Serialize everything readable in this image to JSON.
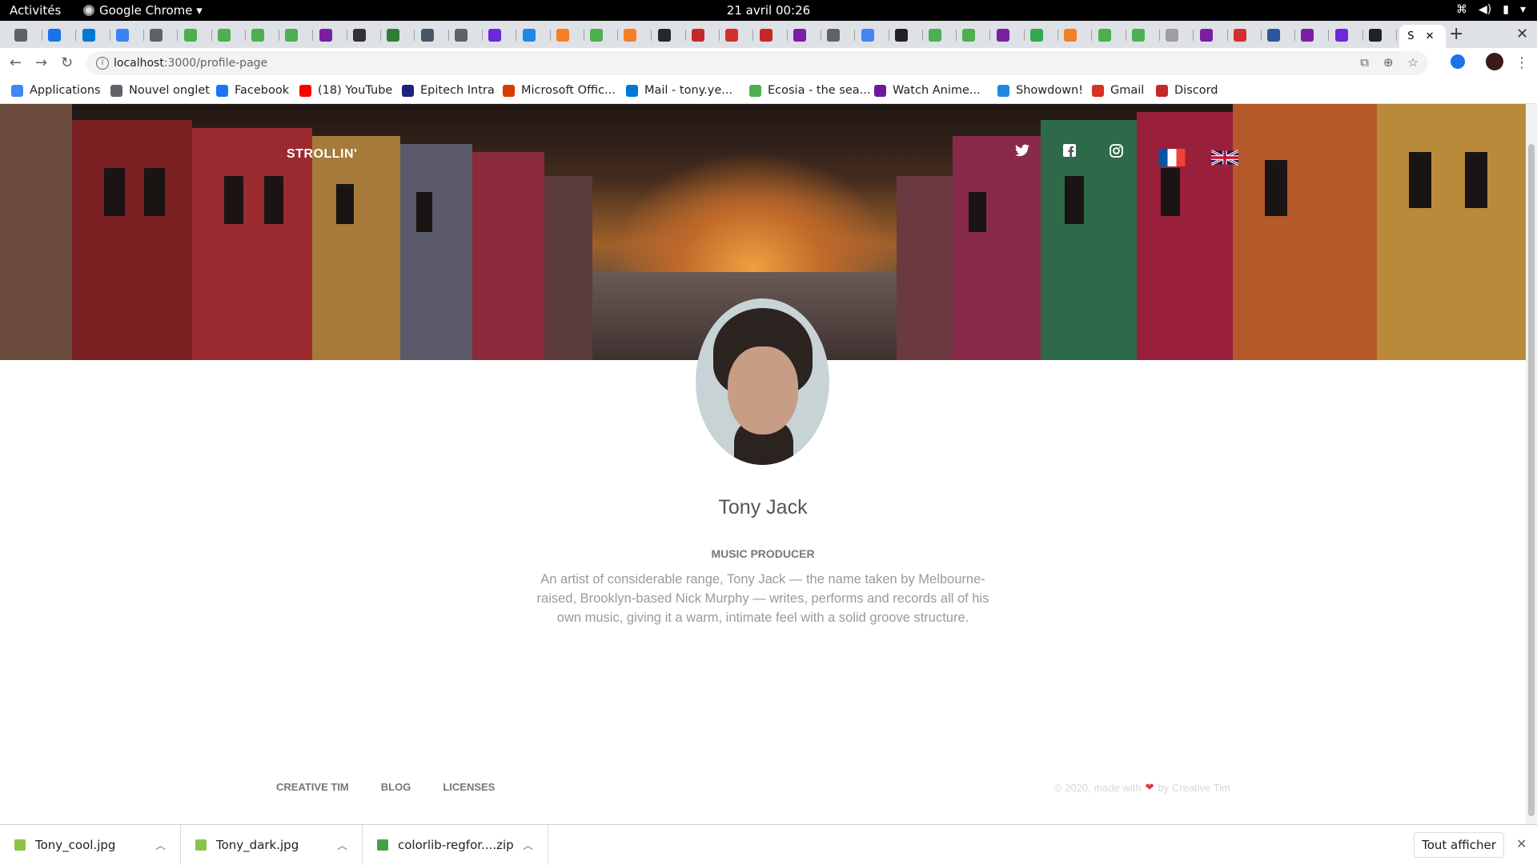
{
  "topbar": {
    "activities": "Activités",
    "app_name": "Google Chrome ▾",
    "datetime": "21 avril  00:26",
    "sys_icons": [
      "network-icon",
      "volume-icon",
      "battery-icon",
      "menu-arrow-icon"
    ]
  },
  "browser": {
    "tab_favicon_colors": [
      "#5f6368",
      "#1a73e8",
      "#0078d4",
      "#3b82f6",
      "#5f6368",
      "#4caf50",
      "#4caf50",
      "#4caf50",
      "#4caf50",
      "#7b1fa2",
      "#333333",
      "#2e7d32",
      "#4a5568",
      "#5f6368",
      "#6d28d9",
      "#1e88e5",
      "#f48024",
      "#4caf50",
      "#f48024",
      "#24292e",
      "#c62828",
      "#d32f2f",
      "#c62828",
      "#7b1fa2",
      "#5f6368",
      "#4285f4",
      "#222222",
      "#4caf50",
      "#4caf50",
      "#7b1fa2",
      "#34a853",
      "#f48024",
      "#4caf50",
      "#4caf50",
      "#9e9e9e",
      "#7b1fa2",
      "#d32f2f",
      "#2b579a",
      "#7b1fa2",
      "#6d28d9",
      "#222222",
      "#ffffff"
    ],
    "active_tab_label": "S",
    "new_tab": "+",
    "close": "✕",
    "url_host": "localhost",
    "url_path": ":3000/profile-page",
    "info_icon": "i"
  },
  "bookmarks": [
    {
      "label": "Applications",
      "color": "#4285f4"
    },
    {
      "label": "Nouvel onglet",
      "color": "#5f6368"
    },
    {
      "label": "Facebook",
      "color": "#1877f2"
    },
    {
      "label": "(18) YouTube",
      "color": "#ff0000"
    },
    {
      "label": "Epitech Intra",
      "color": "#1a237e"
    },
    {
      "label": "Microsoft Offic...",
      "color": "#d83b01"
    },
    {
      "label": "Mail - tony.ye...",
      "color": "#0078d4"
    },
    {
      "label": "Ecosia - the sea...",
      "color": "#4caf50"
    },
    {
      "label": "Watch Anime...",
      "color": "#6a1b9a"
    },
    {
      "label": "Showdown!",
      "color": "#1e88e5"
    },
    {
      "label": "Gmail",
      "color": "#d93025"
    },
    {
      "label": "Discord",
      "color": "#c62828"
    }
  ],
  "site": {
    "brand": "STROLLIN'",
    "social": [
      "twitter-icon",
      "facebook-icon",
      "instagram-icon"
    ],
    "flags": [
      "flag-fr-icon",
      "flag-uk-icon"
    ]
  },
  "profile": {
    "name": "Tony Jack",
    "role": "MUSIC PRODUCER",
    "bio": "An artist of considerable range, Tony Jack — the name taken by Melbourne-raised, Brooklyn-based Nick Murphy — writes, performs and records all of his own music, giving it a warm, intimate feel with a solid groove structure."
  },
  "footer": {
    "links": [
      "CREATIVE TIM",
      "BLOG",
      "LICENSES"
    ],
    "copyright_prefix": "© 2020, made with",
    "heart": "❤",
    "copyright_suffix": "by Creative Tim"
  },
  "downloads": {
    "files": [
      {
        "name": "Tony_cool.jpg",
        "color": "#8bc34a"
      },
      {
        "name": "Tony_dark.jpg",
        "color": "#8bc34a"
      },
      {
        "name": "colorlib-regfor....zip",
        "color": "#43a047"
      }
    ],
    "show_all": "Tout afficher",
    "close": "✕"
  }
}
